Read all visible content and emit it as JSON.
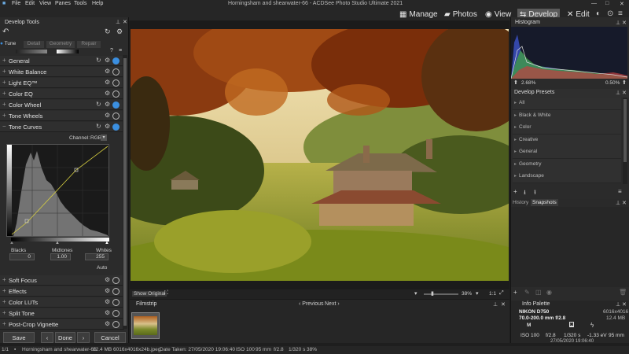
{
  "menu": [
    "File",
    "Edit",
    "View",
    "Panes",
    "Tools",
    "Help"
  ],
  "window_title": "Horningsham and shearwater-66 - ACDSee Photo Studio Ultimate 2021",
  "modes": {
    "manage": "Manage",
    "photos": "Photos",
    "view": "View",
    "develop": "Develop",
    "edit": "Edit",
    "active": "Develop"
  },
  "left": {
    "title": "Develop Tools",
    "tabs": [
      "Tune",
      "Detail",
      "Geometry",
      "Repair"
    ],
    "sections_top": [
      "General",
      "White Balance",
      "Light EQ™",
      "Color EQ",
      "Color Wheel",
      "Tone Wheels",
      "Tone Curves"
    ],
    "channel_label": "Channel:",
    "channel_value": "RGB",
    "blacks_label": "Blacks",
    "blacks_value": "0",
    "midtones_label": "Midtones",
    "midtones_value": "1.00",
    "whites_label": "Whites",
    "whites_value": "255",
    "auto_label": "Auto",
    "sections_bottom": [
      "Soft Focus",
      "Effects",
      "Color LUTs",
      "Split Tone",
      "Post-Crop Vignette"
    ],
    "save": "Save",
    "done": "Done",
    "cancel": "Cancel"
  },
  "image_bar": {
    "show_original": "Show Original",
    "zoom": "38%",
    "page": "1:1"
  },
  "filmstrip": {
    "title": "Filmstrip",
    "previous": "Previous",
    "next": "Next"
  },
  "right": {
    "histogram_title": "Histogram",
    "hist_left": "2.68%",
    "hist_right": "0.50%",
    "presets_title": "Develop Presets",
    "presets": [
      "All",
      "Black & White",
      "Color",
      "Creative",
      "General",
      "Geometry",
      "Landscape"
    ],
    "history_tab": "History",
    "snapshots_tab": "Snapshots",
    "info_title": "Info Palette",
    "camera": "NIKON D750",
    "lens": "70.0-200.0 mm f/2.8",
    "dims": "6016x4016",
    "size": "12.4 MB",
    "mode": "M",
    "iso": "ISO 100",
    "aperture": "f/2.8",
    "shutter": "1/320 s",
    "ev": "-1.33 eV",
    "focal": "95 mm",
    "datetime": "27/05/2020 19:06:40"
  },
  "status": {
    "index": "1/1",
    "filename": "Horningsham and shearwater-66",
    "size": "12.4 MB",
    "format": "6016x4016x24b.jpeg",
    "date": "Date Taken: 27/05/2020 19:06:40",
    "iso": "ISO 100",
    "focal": "95 mm",
    "fstop": "f/2.8",
    "shutter": "1/320 s",
    "zoom": "38%"
  }
}
